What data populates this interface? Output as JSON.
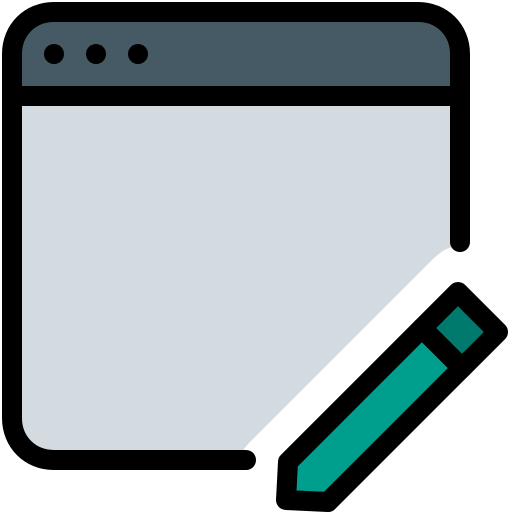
{
  "icon": {
    "name": "browser-window-edit-icon",
    "colors": {
      "outline": "#000000",
      "title_bar": "#455a64",
      "window_body": "#d3dae0",
      "pencil_body": "#009e8c",
      "pencil_eraser": "#007a6c",
      "background": "#ffffff"
    },
    "window_control_dots": 3
  }
}
